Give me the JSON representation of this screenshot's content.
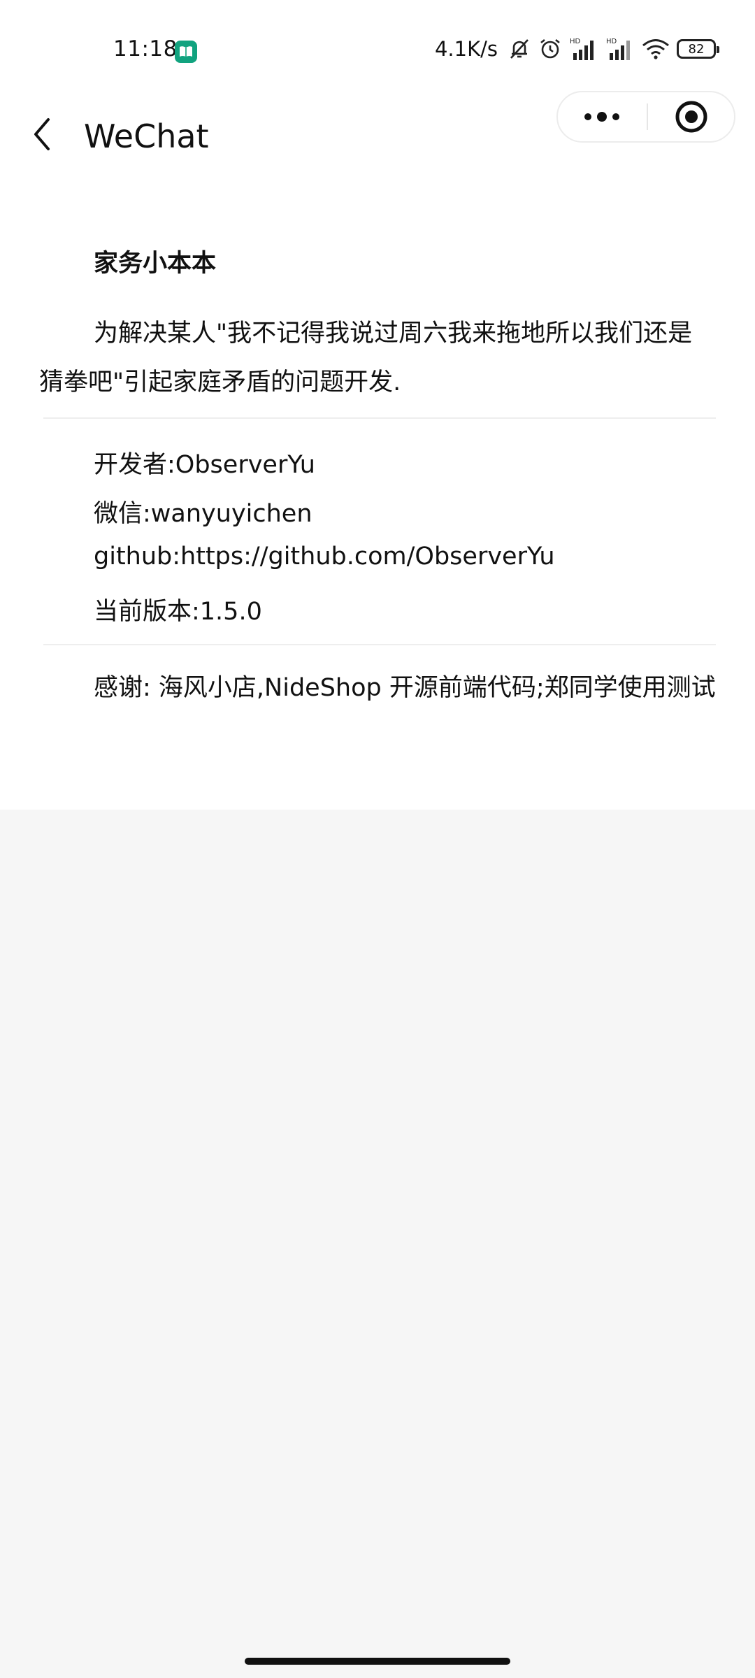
{
  "status_bar": {
    "time": "11:18",
    "net_speed": "4.1K/s",
    "battery": "82",
    "icons": [
      "book-app-icon",
      "mute-bell-icon",
      "alarm-icon",
      "hd-signal-icon",
      "hd-signal-icon",
      "wifi-icon",
      "battery-icon"
    ]
  },
  "nav": {
    "title": "WeChat",
    "back_icon": "chevron-left-icon",
    "more_icon": "more-dots-icon",
    "close_icon": "target-circle-icon"
  },
  "about": {
    "app_name": "家务小本本",
    "description": "为解决某人\"我不记得我说过周六我来拖地所以我们还是猜拳吧\"引起家庭矛盾的问题开发.",
    "developer": "开发者:ObserverYu",
    "wechat": "微信:wanyuyichen",
    "github": "github:https://github.com/ObserverYu",
    "version": "当前版本:1.5.0",
    "thanks": "感谢: 海风小店,NideShop 开源前端代码;郑同学使用测试"
  }
}
